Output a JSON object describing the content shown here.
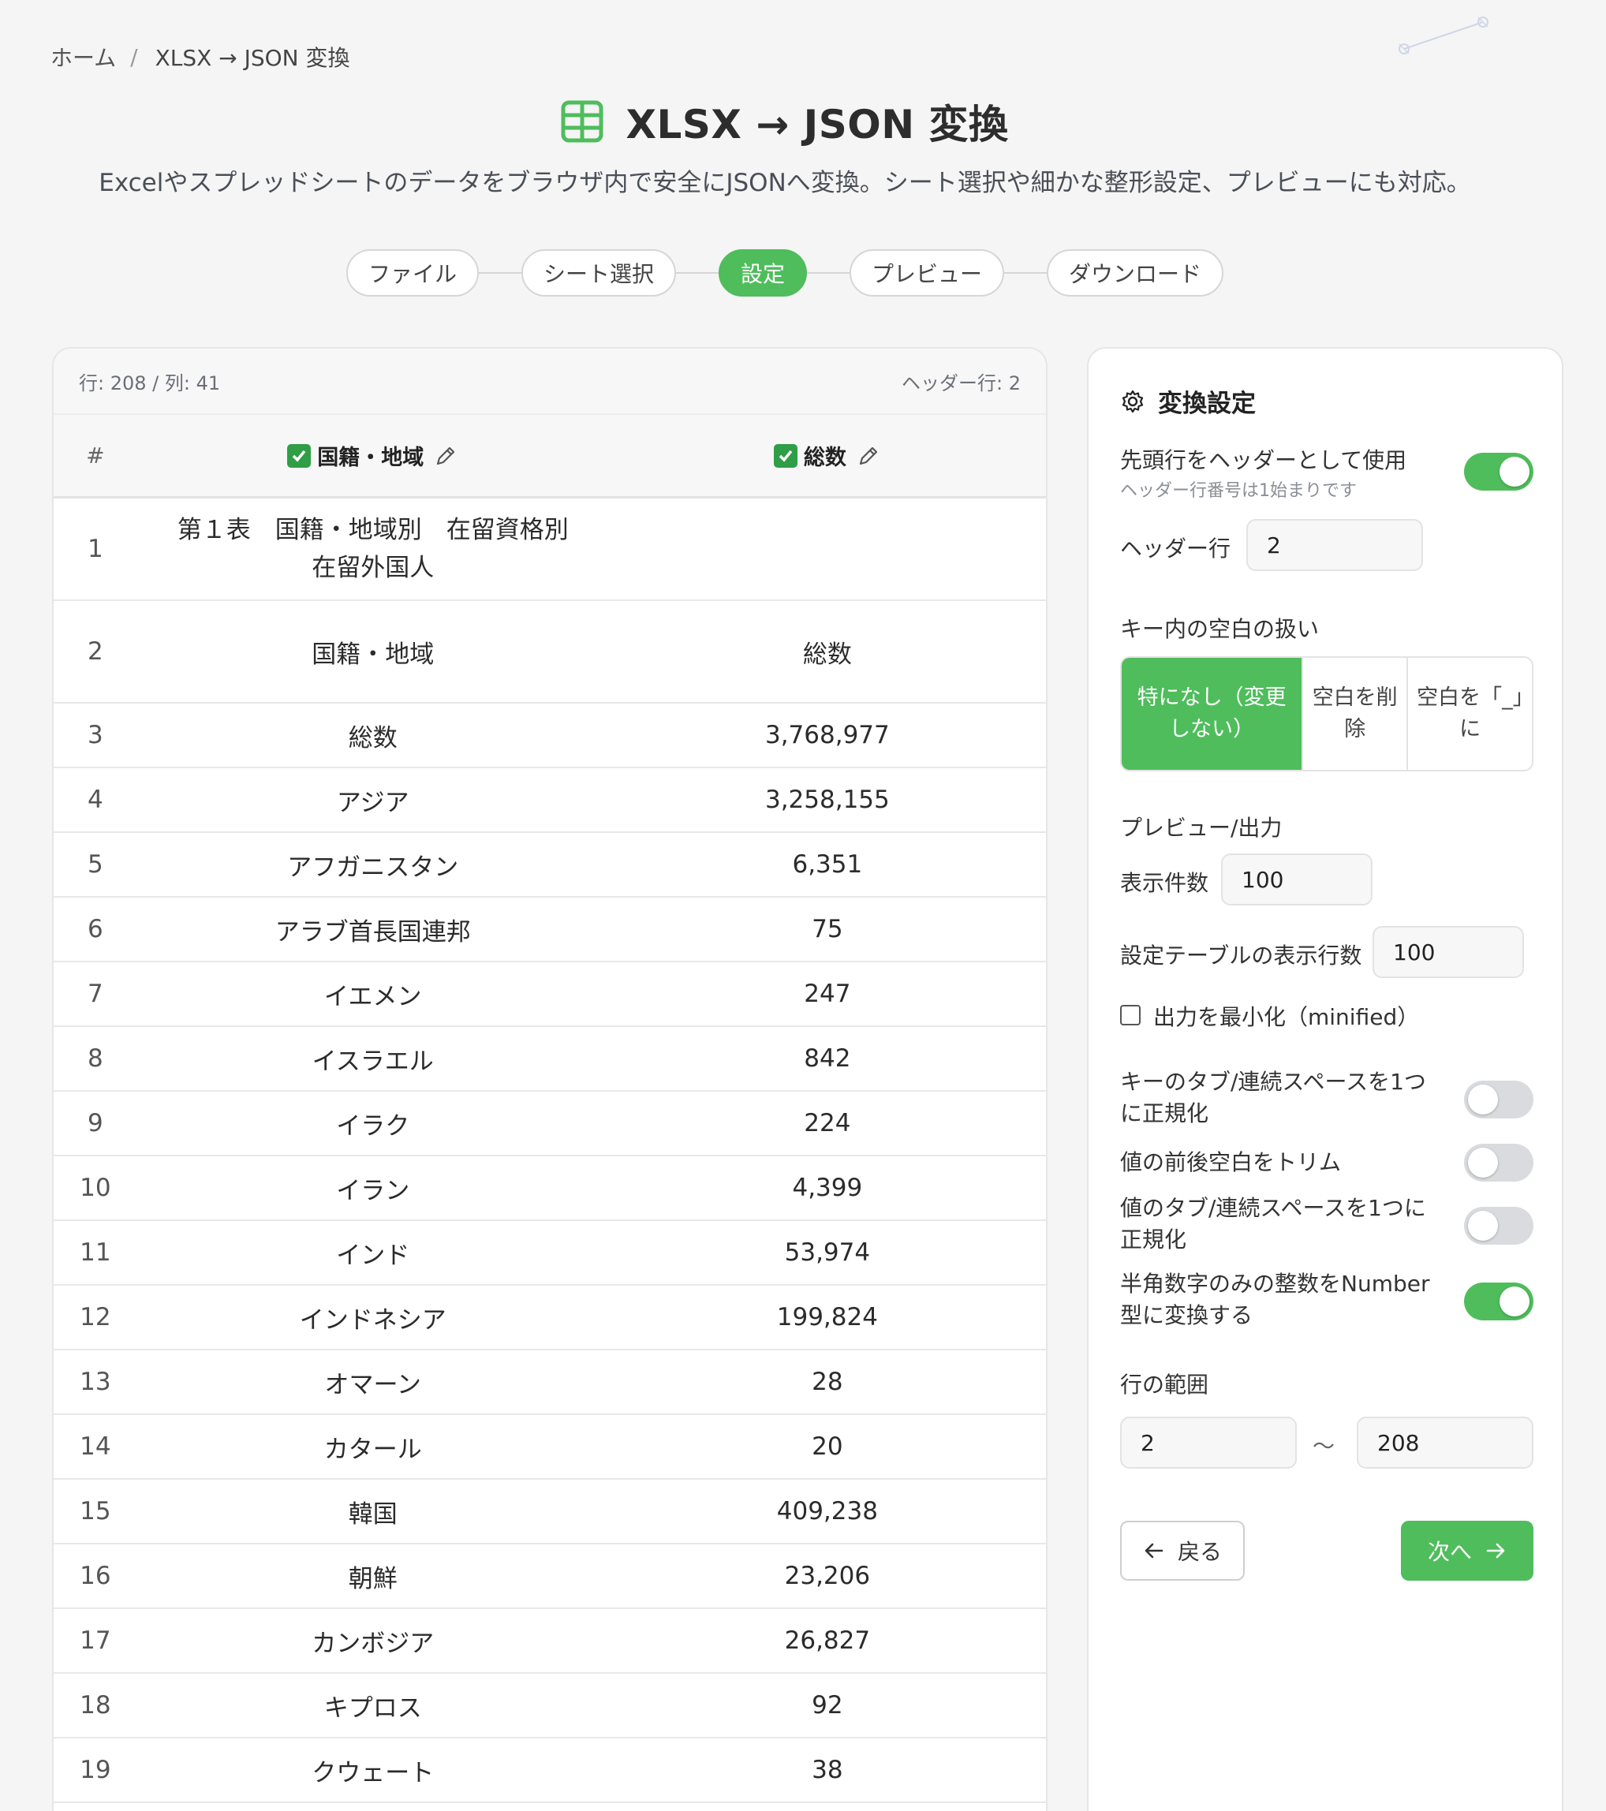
{
  "breadcrumb": {
    "home": "ホーム",
    "separator": "/",
    "current": "XLSX → JSON 変換"
  },
  "header": {
    "title": "XLSX → JSON 変換",
    "subtitle": "Excelやスプレッドシートのデータをブラウザ内で安全にJSONへ変換。シート選択や細かな整形設定、プレビューにも対応。",
    "icon": "table-icon",
    "accent_color": "#4fbd5c"
  },
  "steps": [
    {
      "label": "ファイル",
      "active": false
    },
    {
      "label": "シート選択",
      "active": false
    },
    {
      "label": "設定",
      "active": true
    },
    {
      "label": "プレビュー",
      "active": false
    },
    {
      "label": "ダウンロード",
      "active": false
    }
  ],
  "table": {
    "info_left": "行: 208 / 列: 41",
    "info_right": "ヘッダー行: 2",
    "headers": {
      "num": "#",
      "col1": "国籍・地域",
      "col2": "総数"
    },
    "rows": [
      {
        "n": "1",
        "a": "第１表　国籍・地域別　在留資格別在留外国人",
        "b": ""
      },
      {
        "n": "2",
        "a": "国籍・地域",
        "b": "総数"
      },
      {
        "n": "3",
        "a": "総数",
        "b": "3,768,977"
      },
      {
        "n": "4",
        "a": "アジア",
        "b": "3,258,155"
      },
      {
        "n": "5",
        "a": "アフガニスタン",
        "b": "6,351"
      },
      {
        "n": "6",
        "a": "アラブ首長国連邦",
        "b": "75"
      },
      {
        "n": "7",
        "a": "イエメン",
        "b": "247"
      },
      {
        "n": "8",
        "a": "イスラエル",
        "b": "842"
      },
      {
        "n": "9",
        "a": "イラク",
        "b": "224"
      },
      {
        "n": "10",
        "a": "イラン",
        "b": "4,399"
      },
      {
        "n": "11",
        "a": "インド",
        "b": "53,974"
      },
      {
        "n": "12",
        "a": "インドネシア",
        "b": "199,824"
      },
      {
        "n": "13",
        "a": "オマーン",
        "b": "28"
      },
      {
        "n": "14",
        "a": "カタール",
        "b": "20"
      },
      {
        "n": "15",
        "a": "韓国",
        "b": "409,238"
      },
      {
        "n": "16",
        "a": "朝鮮",
        "b": "23,206"
      },
      {
        "n": "17",
        "a": "カンボジア",
        "b": "26,827"
      },
      {
        "n": "18",
        "a": "キプロス",
        "b": "92"
      },
      {
        "n": "19",
        "a": "クウェート",
        "b": "38"
      }
    ]
  },
  "settings": {
    "title": "変換設定",
    "use_header": {
      "label": "先頭行をヘッダーとして使用",
      "hint": "ヘッダー行番号は1始まりです",
      "on": true
    },
    "header_row": {
      "label": "ヘッダー行",
      "value": "2"
    },
    "whitespace": {
      "label": "キー内の空白の扱い",
      "options": [
        "特になし（変更しない）",
        "空白を削除",
        "空白を「_」に"
      ],
      "selected": 0
    },
    "preview_section": "プレビュー/出力",
    "display_count": {
      "label": "表示件数",
      "value": "100"
    },
    "table_rows": {
      "label": "設定テーブルの表示行数",
      "value": "100"
    },
    "minified": {
      "label": "出力を最小化（minified）",
      "checked": false
    },
    "toggles": [
      {
        "label": "キーのタブ/連続スペースを1つに正規化",
        "on": false
      },
      {
        "label": "値の前後空白をトリム",
        "on": false
      },
      {
        "label": "値のタブ/連続スペースを1つに正規化",
        "on": false
      },
      {
        "label": "半角数字のみの整数をNumber型に変換する",
        "on": true
      }
    ],
    "range": {
      "label": "行の範囲",
      "from": "2",
      "separator": "〜",
      "to": "208"
    },
    "back_label": "戻る",
    "next_label": "次へ"
  }
}
